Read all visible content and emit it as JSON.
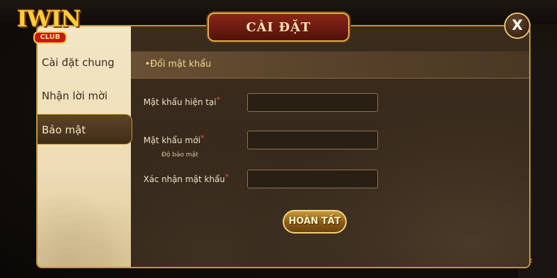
{
  "logo": {
    "text": "IWIN",
    "sub": "CLUB"
  },
  "dialog": {
    "title": "CÀI ĐẶT",
    "close_label": "X"
  },
  "sidebar": {
    "items": [
      {
        "label": "Cài đặt chung"
      },
      {
        "label": "Nhận lời mời"
      },
      {
        "label": "Bảo mật"
      }
    ]
  },
  "section": {
    "title": "•Đổi mật khẩu"
  },
  "form": {
    "current_password_label": "Mật khẩu hiện tại",
    "new_password_label": "Mật khẩu mới",
    "strength_hint": "Độ bảo mật",
    "confirm_password_label": "Xác nhận mật khẩu",
    "required_mark": "*",
    "current_password_value": "",
    "new_password_value": "",
    "confirm_password_value": "",
    "submit_label": "HOÀN TẤT"
  },
  "colors": {
    "accent_gold": "#c9962e",
    "title_red": "#6a1a10",
    "required": "#ff4a4a"
  },
  "icons": {
    "close": "close-icon",
    "settings": "gear-icon"
  }
}
